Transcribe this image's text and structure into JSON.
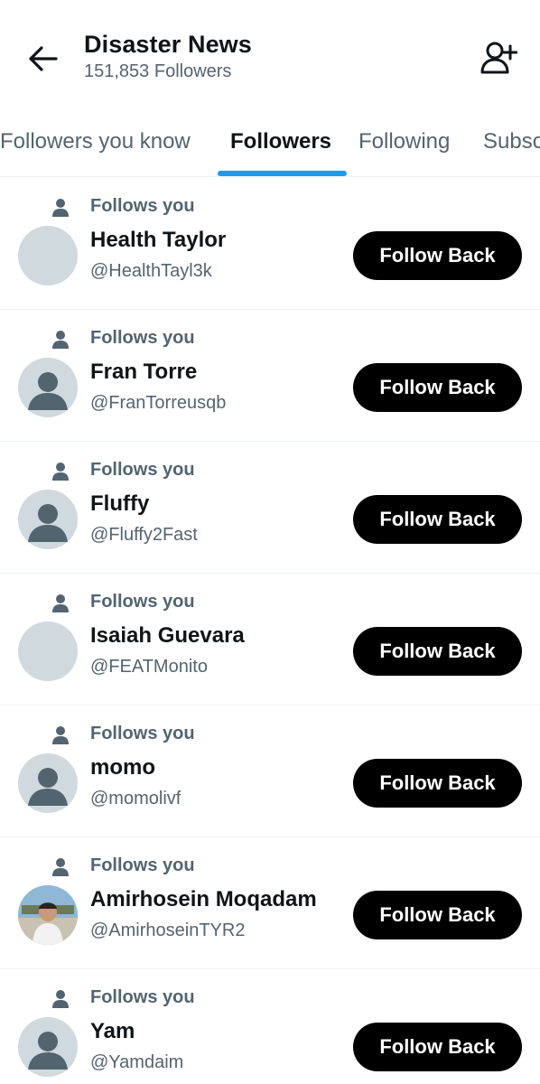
{
  "header": {
    "title": "Disaster News",
    "subtitle": "151,853 Followers",
    "back_icon": "arrow-left-icon",
    "add_user_icon": "person-add-icon"
  },
  "tabs": [
    {
      "label": "Followers you know",
      "active": false
    },
    {
      "label": "Followers",
      "active": true
    },
    {
      "label": "Following",
      "active": false
    },
    {
      "label": "Subscriptions",
      "active": false
    }
  ],
  "colors": {
    "accent": "#1d9bf0",
    "text_primary": "#0f1419",
    "text_secondary": "#536471",
    "button_bg": "#000000",
    "avatar_placeholder": "#cfd9de",
    "avatar_silhouette": "#536471"
  },
  "followers": [
    {
      "follows_label": "Follows you",
      "name": "Health Taylor",
      "handle": "@HealthTayl3k",
      "avatar": "blank",
      "button": "Follow Back"
    },
    {
      "follows_label": "Follows you",
      "name": "Fran Torre",
      "handle": "@FranTorreusqb",
      "avatar": "default-silhouette",
      "button": "Follow Back"
    },
    {
      "follows_label": "Follows you",
      "name": "Fluffy",
      "handle": "@Fluffy2Fast",
      "avatar": "default-silhouette",
      "button": "Follow Back"
    },
    {
      "follows_label": "Follows you",
      "name": "Isaiah Guevara",
      "handle": "@FEATMonito",
      "avatar": "blank",
      "button": "Follow Back"
    },
    {
      "follows_label": "Follows you",
      "name": "momo",
      "handle": "@momolivf",
      "avatar": "default-silhouette",
      "button": "Follow Back"
    },
    {
      "follows_label": "Follows you",
      "name": "Amirhosein Moqadam",
      "handle": "@AmirhoseinTYR2",
      "avatar": "photo",
      "button": "Follow Back"
    },
    {
      "follows_label": "Follows you",
      "name": "Yam",
      "handle": "@Yamdaim",
      "avatar": "default-silhouette",
      "button": "Follow Back"
    }
  ]
}
